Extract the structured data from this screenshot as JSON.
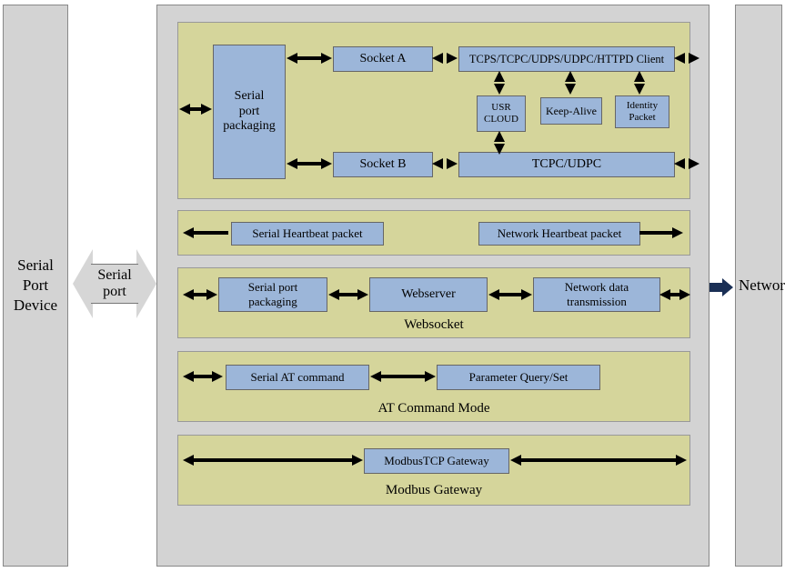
{
  "left_panel": {
    "label": "Serial\nPort\nDevice"
  },
  "right_panel": {
    "label": "Network"
  },
  "serial_port_arrow": "Serial\nport",
  "section1": {
    "serial_port_packaging": "Serial\nport\npackaging",
    "socket_a": "Socket A",
    "socket_b": "Socket B",
    "protocols": "TCPS/TCPC/UDPS/UDPC/HTTPD Client",
    "usr_cloud": "USR\nCLOUD",
    "keep_alive": "Keep-Alive",
    "identity_packet": "Identity\nPacket",
    "tcpc_udpc": "TCPC/UDPC"
  },
  "section2": {
    "serial_hb": "Serial Heartbeat packet",
    "network_hb": "Network Heartbeat packet"
  },
  "section3": {
    "label": "Websocket",
    "serial_port_packaging": "Serial port\npackaging",
    "webserver": "Webserver",
    "network_data": "Network data\ntransmission"
  },
  "section4": {
    "label": "AT Command Mode",
    "serial_at": "Serial AT command",
    "param": "Parameter Query/Set"
  },
  "section5": {
    "label": "Modbus Gateway",
    "modbus": "ModbusTCP Gateway"
  }
}
